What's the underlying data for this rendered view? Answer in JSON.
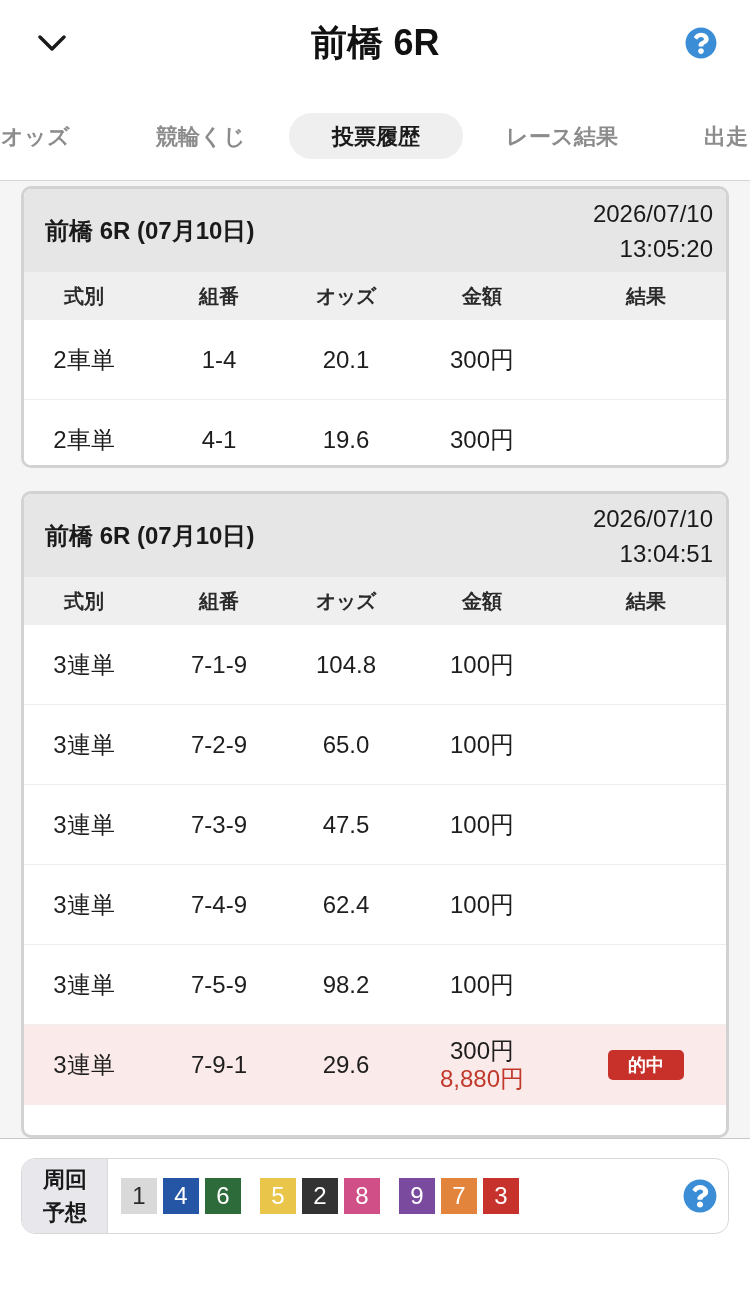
{
  "header": {
    "title": "前橋 6R"
  },
  "tabs": [
    {
      "label": "オッズ",
      "selected": false
    },
    {
      "label": "競輪くじ",
      "selected": false
    },
    {
      "label": "投票履歴",
      "selected": true
    },
    {
      "label": "レース結果",
      "selected": false
    },
    {
      "label": "出走",
      "selected": false
    }
  ],
  "tickets": [
    {
      "title": "前橋 6R (07月10日)",
      "date": "2026/07/10",
      "time": "13:05:20",
      "columns": [
        "式別",
        "組番",
        "オッズ",
        "金額",
        "結果"
      ],
      "rows": [
        {
          "bet_type": "2車単",
          "combination": "1-4",
          "odds": "20.1",
          "amount": "300円",
          "hit": false
        },
        {
          "bet_type": "2車単",
          "combination": "4-1",
          "odds": "19.6",
          "amount": "300円",
          "hit": false
        }
      ]
    },
    {
      "title": "前橋 6R (07月10日)",
      "date": "2026/07/10",
      "time": "13:04:51",
      "columns": [
        "式別",
        "組番",
        "オッズ",
        "金額",
        "結果"
      ],
      "rows": [
        {
          "bet_type": "3連単",
          "combination": "7-1-9",
          "odds": "104.8",
          "amount": "100円",
          "hit": false
        },
        {
          "bet_type": "3連単",
          "combination": "7-2-9",
          "odds": "65.0",
          "amount": "100円",
          "hit": false
        },
        {
          "bet_type": "3連単",
          "combination": "7-3-9",
          "odds": "47.5",
          "amount": "100円",
          "hit": false
        },
        {
          "bet_type": "3連単",
          "combination": "7-4-9",
          "odds": "62.4",
          "amount": "100円",
          "hit": false
        },
        {
          "bet_type": "3連単",
          "combination": "7-5-9",
          "odds": "98.2",
          "amount": "100円",
          "hit": false
        },
        {
          "bet_type": "3連単",
          "combination": "7-9-1",
          "odds": "29.6",
          "amount": "300円",
          "payout": "8,880円",
          "result": "的中",
          "hit": true
        }
      ]
    }
  ],
  "prediction": {
    "label": "周回予想",
    "groups": [
      [
        {
          "number": "1",
          "color": "#d9d9d9"
        },
        {
          "number": "4",
          "color": "#2456a5"
        },
        {
          "number": "6",
          "color": "#2e6b3b"
        }
      ],
      [
        {
          "number": "5",
          "color": "#e9c64a"
        },
        {
          "number": "2",
          "color": "#333333"
        },
        {
          "number": "8",
          "color": "#d04f86"
        }
      ],
      [
        {
          "number": "9",
          "color": "#7a4a9f"
        },
        {
          "number": "7",
          "color": "#e2843b"
        },
        {
          "number": "3",
          "color": "#c8322c"
        }
      ]
    ]
  }
}
